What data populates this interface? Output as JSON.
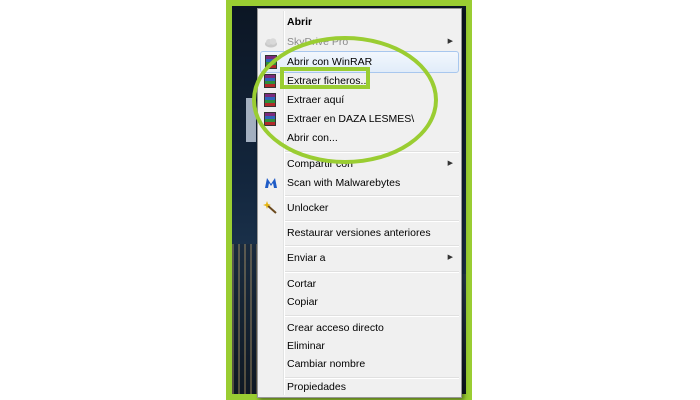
{
  "context_menu": {
    "items": [
      {
        "label": "Abrir",
        "bold": true
      },
      {
        "label": "SkyDrive Pro",
        "disabled": true,
        "submenu": true,
        "icon": "cloud-icon"
      },
      {
        "label": "Abrir con WinRAR",
        "icon": "winrar-icon"
      },
      {
        "label": "Extraer ficheros...",
        "icon": "winrar-icon"
      },
      {
        "label": "Extraer aquí",
        "icon": "winrar-icon"
      },
      {
        "label": "Extraer en DAZA LESMES\\",
        "icon": "winrar-icon"
      },
      {
        "label": "Abrir con..."
      },
      {
        "label": "Compartir con",
        "submenu": true
      },
      {
        "label": "Scan with Malwarebytes",
        "icon": "malwarebytes-icon"
      },
      {
        "label": "Unlocker",
        "icon": "wand-icon"
      },
      {
        "label": "Restaurar versiones anteriores"
      },
      {
        "label": "Enviar a",
        "submenu": true
      },
      {
        "label": "Cortar"
      },
      {
        "label": "Copiar"
      },
      {
        "label": "Crear acceso directo"
      },
      {
        "label": "Eliminar"
      },
      {
        "label": "Cambiar nombre"
      },
      {
        "label": "Propiedades"
      }
    ],
    "submenu_arrow": "▶"
  },
  "colors": {
    "highlight": "#9acd32",
    "menu_background": "#f0f0f0",
    "hover_border": "#a8c7ee",
    "malwarebytes": "#1e5bc6"
  }
}
